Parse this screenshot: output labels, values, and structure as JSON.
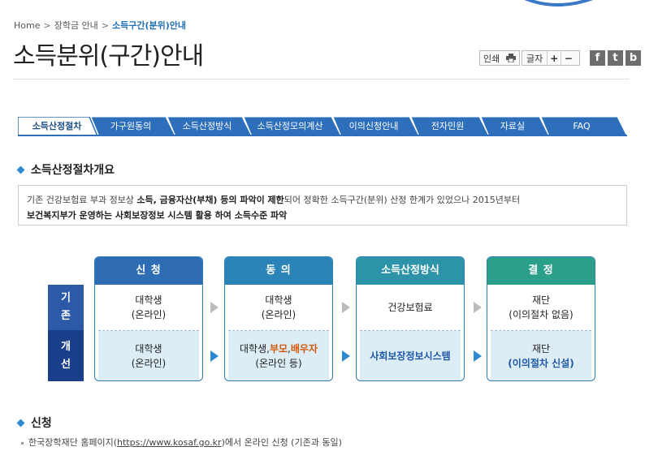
{
  "breadcrumb": {
    "home": "Home",
    "level1": "장학금 안내",
    "current": "소득구간(분위)안내"
  },
  "page_title": "소득분위(구간)안내",
  "tools": {
    "print": "인쇄",
    "font_size": "글자",
    "plus": "+",
    "minus": "−",
    "facebook": "f",
    "twitter": "t",
    "blog": "b"
  },
  "tabs": [
    {
      "label": "소득산정절차",
      "active": true
    },
    {
      "label": "가구원동의"
    },
    {
      "label": "소득산정방식"
    },
    {
      "label": "소득산정모의계산"
    },
    {
      "label": "이의신청안내"
    },
    {
      "label": "전자민원"
    },
    {
      "label": "자료실"
    },
    {
      "label": "FAQ"
    }
  ],
  "overview": {
    "heading": "소득산정절차개요",
    "text1": "기존 건강보험료 부과 정보상 ",
    "bold1": "소득, 금융자산(부채) 등의 파악이 제한",
    "text2": "되어 정확한 소득구간(분위) 산정 한계가 있었으나 2015년부터",
    "bold2": "보건복지부가 운영하는 사회보장정보 시스템 활용 하여 소득수준 파악"
  },
  "flow": {
    "row_existing": [
      "기",
      "존"
    ],
    "row_improved": [
      "개",
      "선"
    ],
    "steps": [
      {
        "title": "신 청",
        "top_line1": "대학생",
        "top_line2": "(온라인)",
        "bot_line1": "대학생",
        "bot_line2": "(온라인)"
      },
      {
        "title": "동 의",
        "top_line1": "대학생",
        "top_line2": "(온라인)",
        "bot_a": "대학생,",
        "bot_b": "부모",
        "bot_c": ",",
        "bot_d": "배우자",
        "bot_line2": "(온라인 등)"
      },
      {
        "title": "소득산정방식",
        "top_line1": "건강보험료",
        "bot_line1": "사회보장정보시스템"
      },
      {
        "title": "결 정",
        "top_line1": "재단",
        "top_line2": "(이의절차 없음)",
        "bot_line1": "재단",
        "bot_line2": "(이의절차 신설)"
      }
    ],
    "colors": {
      "head1": "#2e6db4",
      "head2": "#2a84b8",
      "head3": "#2c93a8",
      "head4": "#2aa08a"
    }
  },
  "apply": {
    "heading": "신청",
    "text_before": "한국장학재단 홈페이지(",
    "link": "https://www.kosaf.go.kr",
    "text_after": ")에서 온라인 신청 (기존과 동일)"
  }
}
